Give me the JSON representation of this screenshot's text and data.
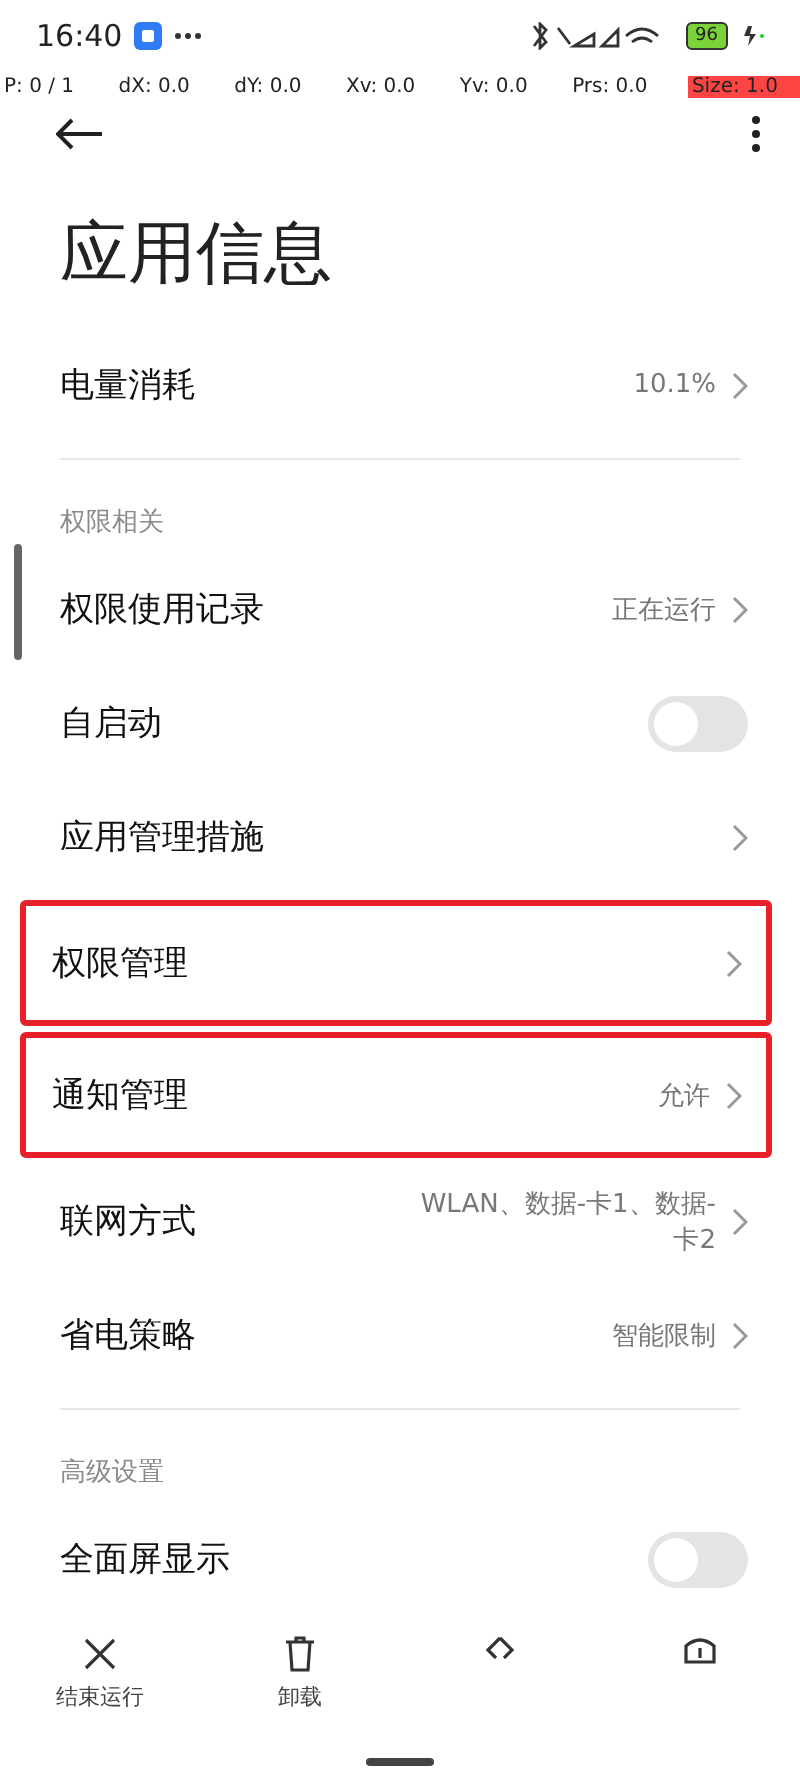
{
  "status_bar": {
    "time": "16:40",
    "battery": "96"
  },
  "debug_bar": [
    {
      "text": "P: 0 / 1",
      "alert": false
    },
    {
      "text": "dX: 0.0",
      "alert": false
    },
    {
      "text": "dY: 0.0",
      "alert": false
    },
    {
      "text": "Xv: 0.0",
      "alert": false
    },
    {
      "text": "Yv: 0.0",
      "alert": false
    },
    {
      "text": "Prs: 0.0",
      "alert": false
    },
    {
      "text": "Size: 1.0",
      "alert": true
    }
  ],
  "title": "应用信息",
  "sections": [
    {
      "rows": [
        {
          "kind": "link",
          "label": "电量消耗",
          "value": "10.1%",
          "highlighted": false
        }
      ]
    },
    {
      "header": "权限相关",
      "rows": [
        {
          "kind": "link",
          "label": "权限使用记录",
          "value": "正在运行",
          "highlighted": false
        },
        {
          "kind": "toggle",
          "label": "自启动",
          "on": false,
          "highlighted": false
        },
        {
          "kind": "link",
          "label": "应用管理措施",
          "highlighted": false
        },
        {
          "kind": "link",
          "label": "权限管理",
          "highlighted": true
        },
        {
          "kind": "link",
          "label": "通知管理",
          "value": "允许",
          "highlighted": true
        },
        {
          "kind": "link",
          "label": "联网方式",
          "value": "WLAN、数据-卡1、数据-卡2",
          "highlighted": false
        },
        {
          "kind": "link",
          "label": "省电策略",
          "value": "智能限制",
          "highlighted": false
        }
      ]
    },
    {
      "header": "高级设置",
      "rows": [
        {
          "kind": "toggle",
          "label": "全面屏显示",
          "on": false,
          "highlighted": false
        }
      ]
    }
  ],
  "bottom_bar": [
    {
      "kind": "close",
      "label": "结束运行"
    },
    {
      "kind": "trash",
      "label": "卸载"
    },
    {
      "kind": "clear"
    },
    {
      "kind": "shield"
    }
  ]
}
